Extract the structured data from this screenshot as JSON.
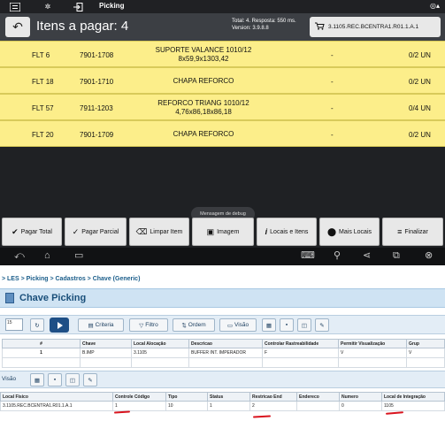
{
  "status_bar": {
    "title": "Picking"
  },
  "header": {
    "title": "Itens a pagar: 4",
    "info_line1": "Total: 4. Resposta: 550 ms.",
    "info_line2": "Version: 3.9.8.8",
    "cart_label": "3.1105.REC.BCENTRA1.R01.1.A.1"
  },
  "items": [
    {
      "code": "FLT 6",
      "ref": "7901-1708",
      "desc1": "SUPORTE VALANCE 1010/12",
      "desc2": "8x59,9x1303,42",
      "dash": "-",
      "qty": "0/2 UN"
    },
    {
      "code": "FLT 18",
      "ref": "7901-1710",
      "desc1": "CHAPA REFORCO",
      "desc2": "",
      "dash": "-",
      "qty": "0/2 UN"
    },
    {
      "code": "FLT 57",
      "ref": "7911-1203",
      "desc1": "REFORCO TRIANG 1010/12",
      "desc2": "4,76x86,18x86,18",
      "dash": "-",
      "qty": "0/4 UN"
    },
    {
      "code": "FLT 20",
      "ref": "7901-1709",
      "desc1": "CHAPA REFORCO",
      "desc2": "",
      "dash": "-",
      "qty": "0/2 UN"
    }
  ],
  "debug_label": "Mensagem de debug",
  "actions": {
    "pagar_total": "Pagar Total",
    "pagar_parcial": "Pagar Parcial",
    "limpar_item": "Limpar Item",
    "imagem": "Imagem",
    "locais_itens": "Locais e Itens",
    "mais_locais": "Mais Locais",
    "finalizar": "Finalizar"
  },
  "web": {
    "breadcrumb": "> LES > Picking > Cadastros > Chave (Generic)",
    "page_title": "Chave Picking",
    "page_size": "15",
    "toolbar": {
      "criteria": "Criteria",
      "filtro": "Filtro",
      "ordem": "Ordem",
      "visao": "Visão"
    },
    "grid1": {
      "headers": [
        "#",
        "Chave",
        "Local Alocação",
        "Descricao",
        "Controlar Rastreabilidade",
        "Permitir Visualização",
        "Grup"
      ],
      "row": [
        "1",
        "B.IMP",
        "3.1105",
        "BUFFER INT. IMPERADOR",
        "F",
        "V",
        "V"
      ]
    },
    "visao_label": "Visão",
    "grid2": {
      "headers": [
        "Local Fisico",
        "Controle Código",
        "Tipo",
        "Status",
        "Restricao End",
        "Endereco",
        "Numero",
        "Local de Integração"
      ],
      "row": [
        "3.1105.REC.BCENTRA1.R01.1.A.1",
        "1",
        "10",
        "1",
        "2",
        "",
        "0",
        "1105"
      ]
    }
  }
}
